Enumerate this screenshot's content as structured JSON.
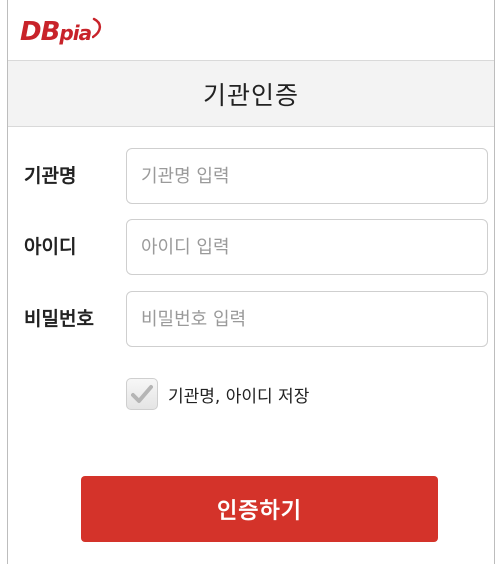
{
  "logo": {
    "text_big": "DB",
    "text_small": "pia",
    "brand_color": "#c8232a"
  },
  "header": {
    "title": "기관인증"
  },
  "form": {
    "institution": {
      "label": "기관명",
      "placeholder": "기관명 입력",
      "value": ""
    },
    "user_id": {
      "label": "아이디",
      "placeholder": "아이디 입력",
      "value": ""
    },
    "password": {
      "label": "비밀번호",
      "placeholder": "비밀번호 입력",
      "value": ""
    },
    "save": {
      "label": "기관명, 아이디 저장",
      "checked": true,
      "icon": "checkmark-icon"
    },
    "submit_label": "인증하기",
    "submit_color": "#d4332a"
  }
}
